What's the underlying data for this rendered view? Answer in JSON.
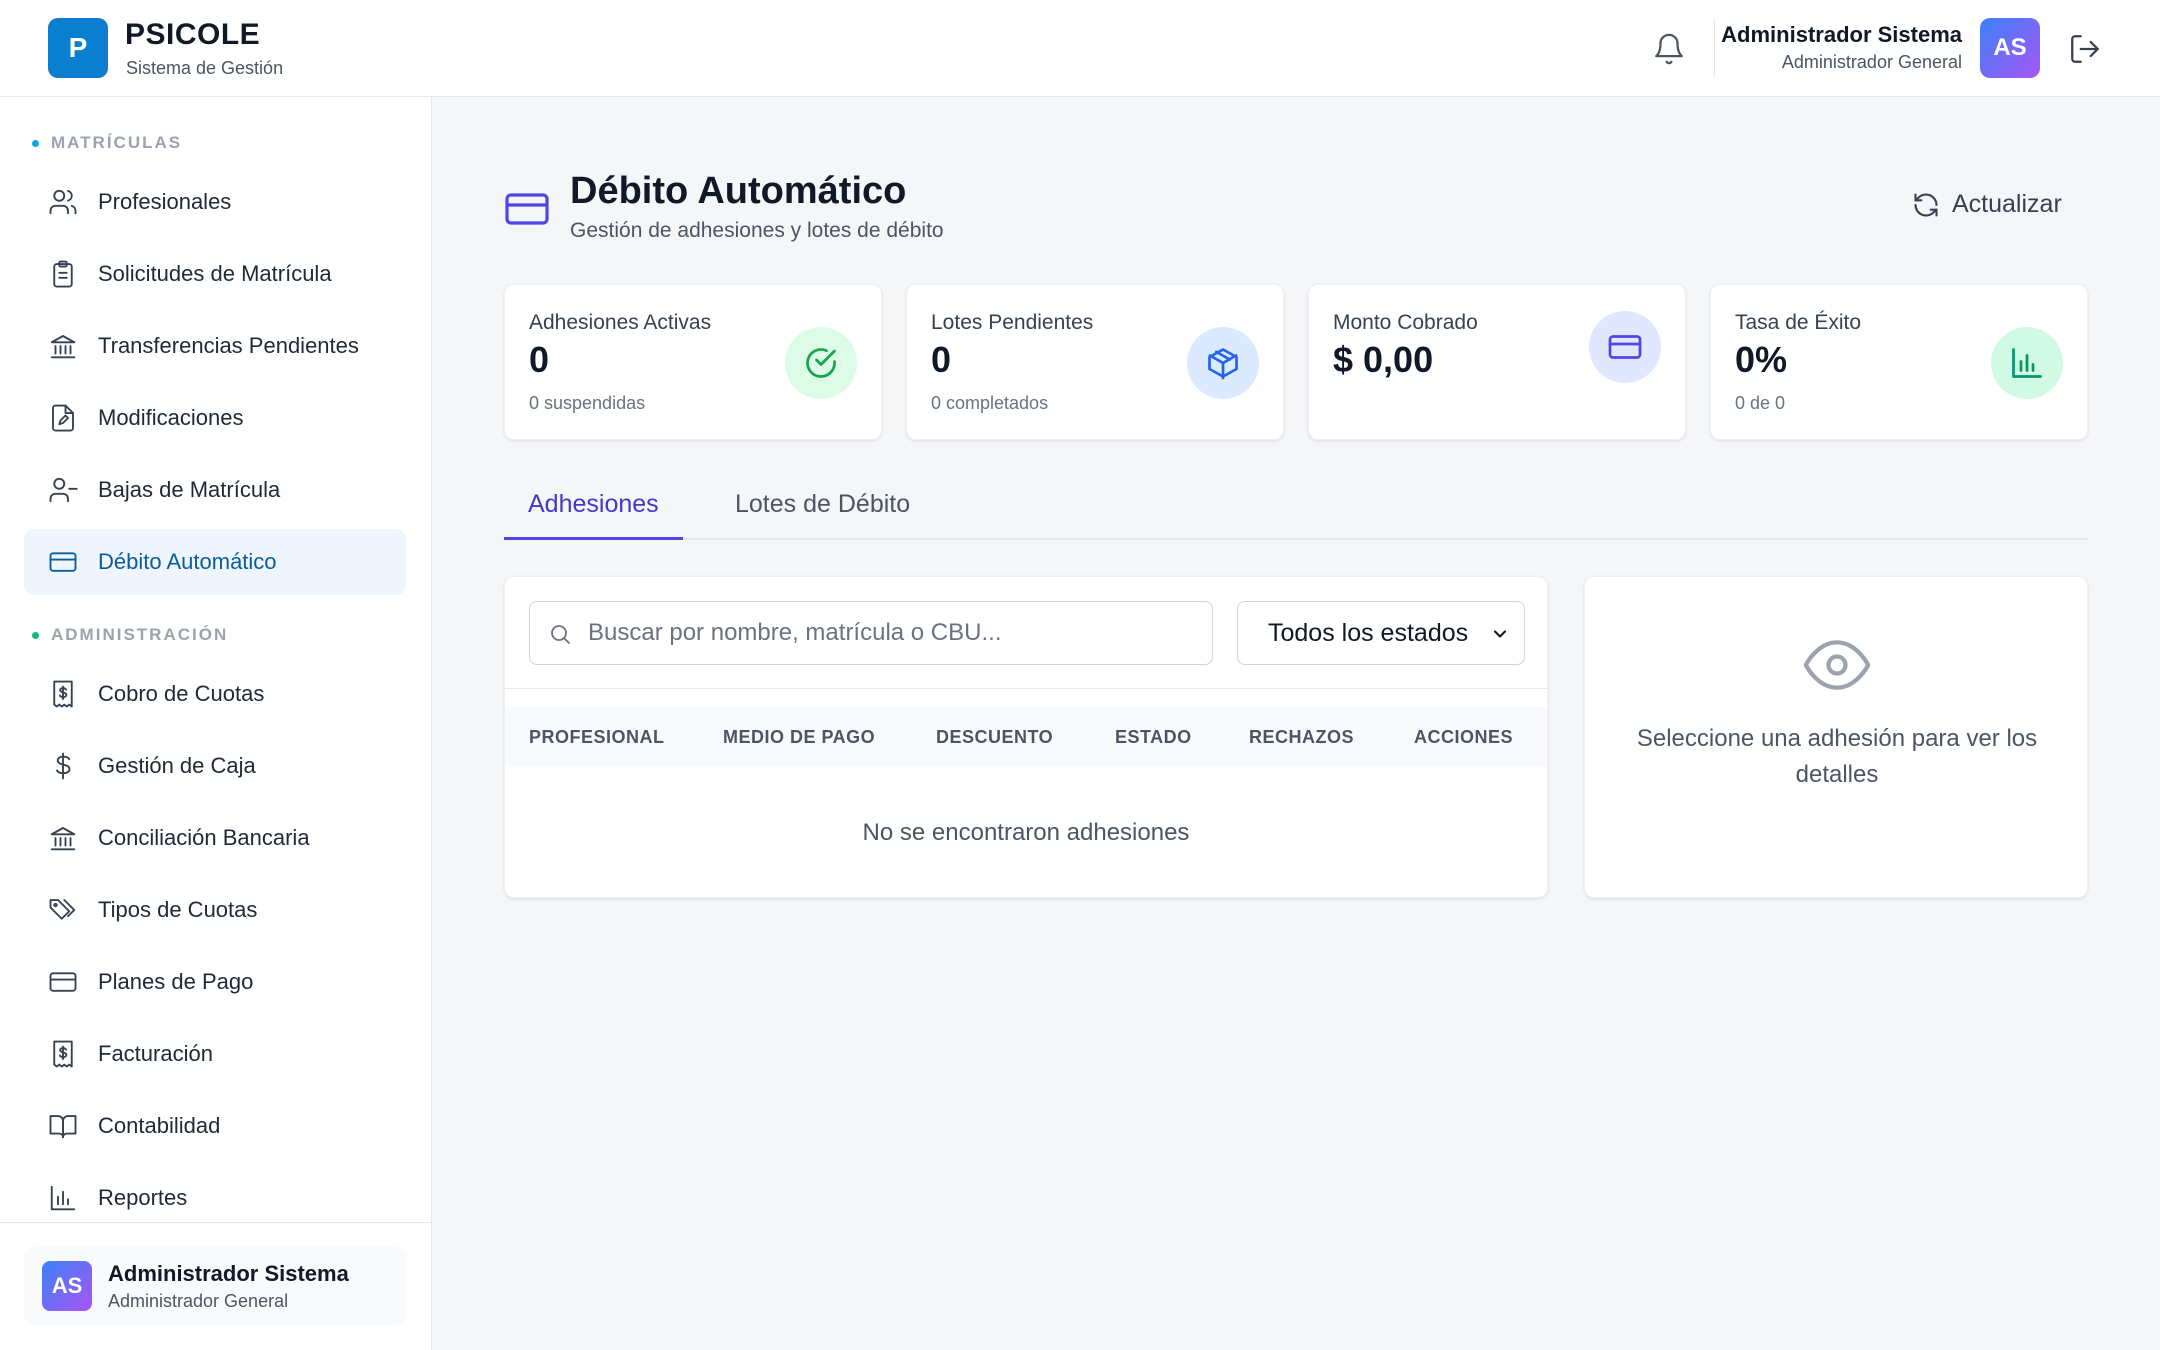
{
  "app": {
    "logo_letter": "P",
    "title": "PSICOLE",
    "subtitle": "Sistema de Gestión"
  },
  "header": {
    "user_name": "Administrador Sistema",
    "user_role": "Administrador General",
    "avatar_initials": "AS",
    "icons": [
      "bell-icon",
      "logout-icon"
    ]
  },
  "sidebar": {
    "sections": [
      {
        "title": "MATRÍCULAS",
        "dot_color": "#0ea5e9",
        "items": [
          {
            "label": "Profesionales",
            "icon": "users-icon"
          },
          {
            "label": "Solicitudes de Matrícula",
            "icon": "clipboard-icon"
          },
          {
            "label": "Transferencias Pendientes",
            "icon": "bank-icon"
          },
          {
            "label": "Modificaciones",
            "icon": "file-edit-icon"
          },
          {
            "label": "Bajas de Matrícula",
            "icon": "user-minus-icon"
          },
          {
            "label": "Débito Automático",
            "icon": "credit-card-icon",
            "active": true
          }
        ]
      },
      {
        "title": "ADMINISTRACIÓN",
        "dot_color": "#10b981",
        "items": [
          {
            "label": "Cobro de Cuotas",
            "icon": "receipt-icon"
          },
          {
            "label": "Gestión de Caja",
            "icon": "dollar-icon"
          },
          {
            "label": "Conciliación Bancaria",
            "icon": "bank-icon"
          },
          {
            "label": "Tipos de Cuotas",
            "icon": "tags-icon"
          },
          {
            "label": "Planes de Pago",
            "icon": "credit-card-icon"
          },
          {
            "label": "Facturación",
            "icon": "receipt-icon"
          },
          {
            "label": "Contabilidad",
            "icon": "book-icon"
          },
          {
            "label": "Reportes",
            "icon": "bar-chart-icon"
          }
        ]
      }
    ],
    "footer": {
      "avatar_initials": "AS",
      "name": "Administrador Sistema",
      "role": "Administrador General"
    }
  },
  "page": {
    "title": "Débito Automático",
    "subtitle": "Gestión de adhesiones y lotes de débito",
    "refresh_label": "Actualizar"
  },
  "stats": [
    {
      "label": "Adhesiones Activas",
      "value": "0",
      "sub": "0 suspendidas",
      "icon": "check-circle-icon",
      "icon_bg": "#dcfce7",
      "icon_color": "#16a34a"
    },
    {
      "label": "Lotes Pendientes",
      "value": "0",
      "sub": "0 completados",
      "icon": "package-icon",
      "icon_bg": "#dbeafe",
      "icon_color": "#2563eb"
    },
    {
      "label": "Monto Cobrado",
      "value": "$ 0,00",
      "sub": "",
      "icon": "credit-card-icon",
      "icon_bg": "#e0e7ff",
      "icon_color": "#4f46e5"
    },
    {
      "label": "Tasa de Éxito",
      "value": "0%",
      "sub": "0 de 0",
      "icon": "bar-chart-icon",
      "icon_bg": "#d1fae5",
      "icon_color": "#059669"
    }
  ],
  "tabs": [
    {
      "label": "Adhesiones",
      "active": true
    },
    {
      "label": "Lotes de Débito",
      "active": false
    }
  ],
  "table": {
    "search_placeholder": "Buscar por nombre, matrícula o CBU...",
    "search_value": "",
    "status_filter": "Todos los estados",
    "columns": [
      "PROFESIONAL",
      "MEDIO DE PAGO",
      "DESCUENTO",
      "ESTADO",
      "RECHAZOS",
      "ACCIONES"
    ],
    "rows": [],
    "empty_message": "No se encontraron adhesiones"
  },
  "detail": {
    "message": "Seleccione una adhesión para ver los detalles"
  },
  "colors": {
    "brand": "#0a7fcf",
    "active_nav_bg": "#eef5fc",
    "active_nav_text": "#0b5d99",
    "tab_active": "#4f46e5"
  }
}
